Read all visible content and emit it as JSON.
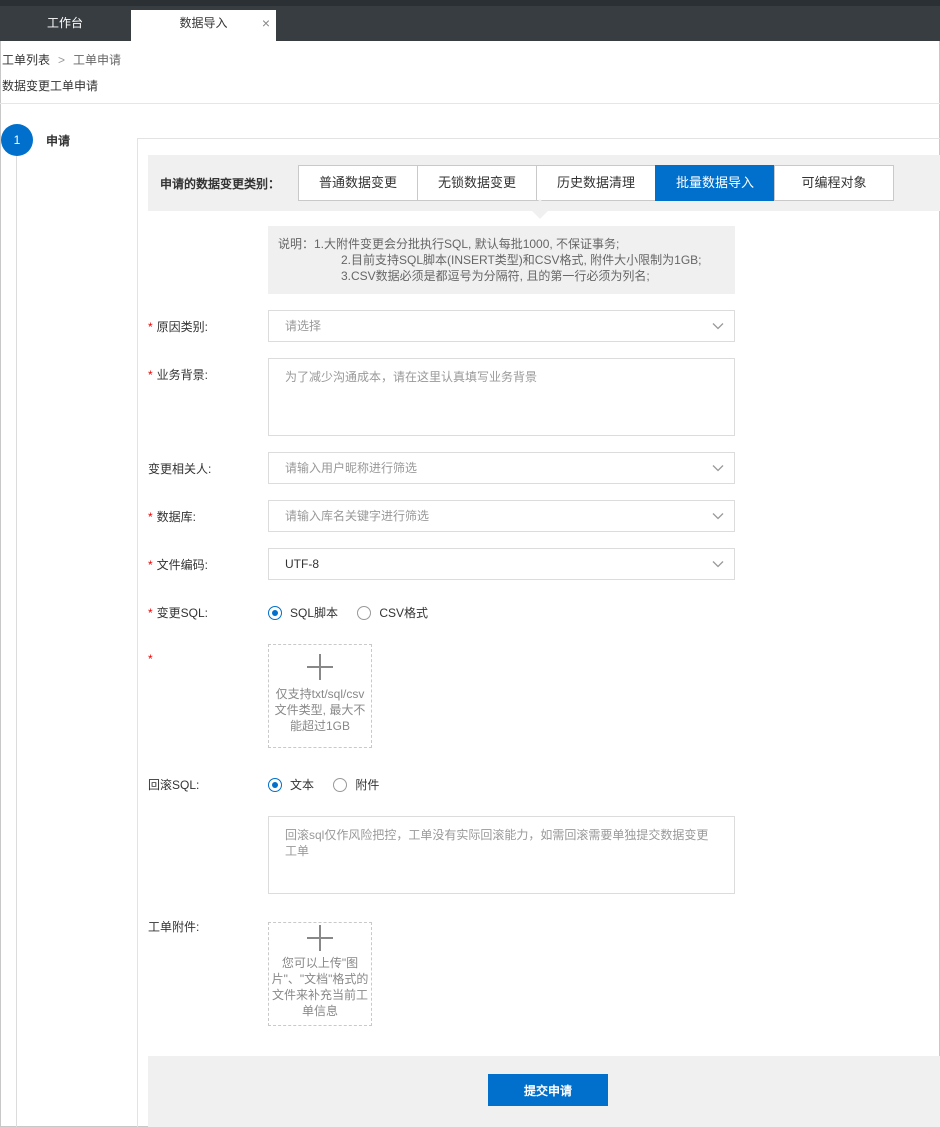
{
  "tabs": [
    {
      "label": "工作台"
    },
    {
      "label": "数据导入",
      "close": "×"
    }
  ],
  "breadcrumb": {
    "parent": "工单列表",
    "separator": ">",
    "current": "工单申请"
  },
  "page_title": "数据变更工单申请",
  "step": {
    "number": "1",
    "label": "申请"
  },
  "change_type": {
    "label": "申请的数据变更类别：",
    "options": [
      "普通数据变更",
      "无锁数据变更",
      "历史数据清理",
      "批量数据导入",
      "可编程对象"
    ],
    "selected": "批量数据导入"
  },
  "note": {
    "line1": "说明：1.大附件变更会分批执行SQL, 默认每批1000, 不保证事务;",
    "line2": "2.目前支持SQL脚本(INSERT类型)和CSV格式, 附件大小限制为1GB;",
    "line3": "3.CSV数据必须是都逗号为分隔符, 且的第一行必须为列名;"
  },
  "form": {
    "reason": {
      "label": "原因类别:",
      "placeholder": "请选择"
    },
    "background": {
      "label": "业务背景:",
      "placeholder": "为了减少沟通成本，请在这里认真填写业务背景"
    },
    "stakeholders": {
      "label": "变更相关人:",
      "placeholder": "请输入用户昵称进行筛选"
    },
    "database": {
      "label": "数据库:",
      "placeholder": "请输入库名关键字进行筛选"
    },
    "encoding": {
      "label": "文件编码:",
      "value": "UTF-8"
    },
    "change_sql": {
      "label": "变更SQL:",
      "options": [
        "SQL脚本",
        "CSV格式"
      ],
      "selected": "SQL脚本"
    },
    "sql_upload": {
      "hint": "仅支持txt/sql/csv文件类型, 最大不能超过1GB"
    },
    "rollback_sql": {
      "label": "回滚SQL:",
      "options": [
        "文本",
        "附件"
      ],
      "selected": "文本",
      "placeholder": "回滚sql仅作风险把控，工单没有实际回滚能力，如需回滚需要单独提交数据变更工单"
    },
    "attachment": {
      "label": "工单附件:",
      "hint": "您可以上传\"图片\"、\"文档\"格式的文件来补充当前工单信息"
    }
  },
  "required_mark": "*",
  "submit_label": "提交申请",
  "colors": {
    "primary": "#0070cc",
    "topbar": "#373d41",
    "required": "#e00000"
  }
}
